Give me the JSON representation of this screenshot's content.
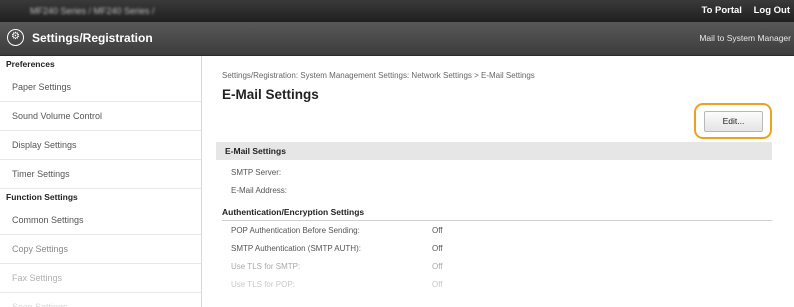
{
  "topbar": {
    "device_title": "MF240 Series / MF240 Series /",
    "portal_link": "To Portal",
    "logout_link": "Log Out"
  },
  "header": {
    "title": "Settings/Registration",
    "mail_link": "Mail to System Manager"
  },
  "sidebar": {
    "preferences_heading": "Preferences",
    "preferences_items": [
      {
        "label": "Paper Settings"
      },
      {
        "label": "Sound Volume Control"
      },
      {
        "label": "Display Settings"
      },
      {
        "label": "Timer Settings"
      }
    ],
    "function_heading": "Function Settings",
    "function_items": [
      {
        "label": "Common Settings"
      },
      {
        "label": "Copy Settings"
      },
      {
        "label": "Fax Settings"
      },
      {
        "label": "Scan Settings"
      }
    ]
  },
  "main": {
    "breadcrumb": "Settings/Registration: System Management Settings: Network Settings > E-Mail Settings",
    "page_title": "E-Mail Settings",
    "edit_button": "Edit...",
    "section_title": "E-Mail Settings",
    "fields": [
      {
        "label": "SMTP Server:",
        "value": ""
      },
      {
        "label": "E-Mail Address:",
        "value": ""
      }
    ],
    "auth_heading": "Authentication/Encryption Settings",
    "auth_fields": [
      {
        "label": "POP Authentication Before Sending:",
        "value": "Off"
      },
      {
        "label": "SMTP Authentication (SMTP AUTH):",
        "value": "Off"
      },
      {
        "label": "Use TLS for SMTP:",
        "value": "Off"
      },
      {
        "label": "Use TLS for POP:",
        "value": "Off"
      }
    ]
  },
  "colors": {
    "highlight": "#f0a020",
    "topbar": "#2a2a2a",
    "header": "#4a4a4a"
  }
}
